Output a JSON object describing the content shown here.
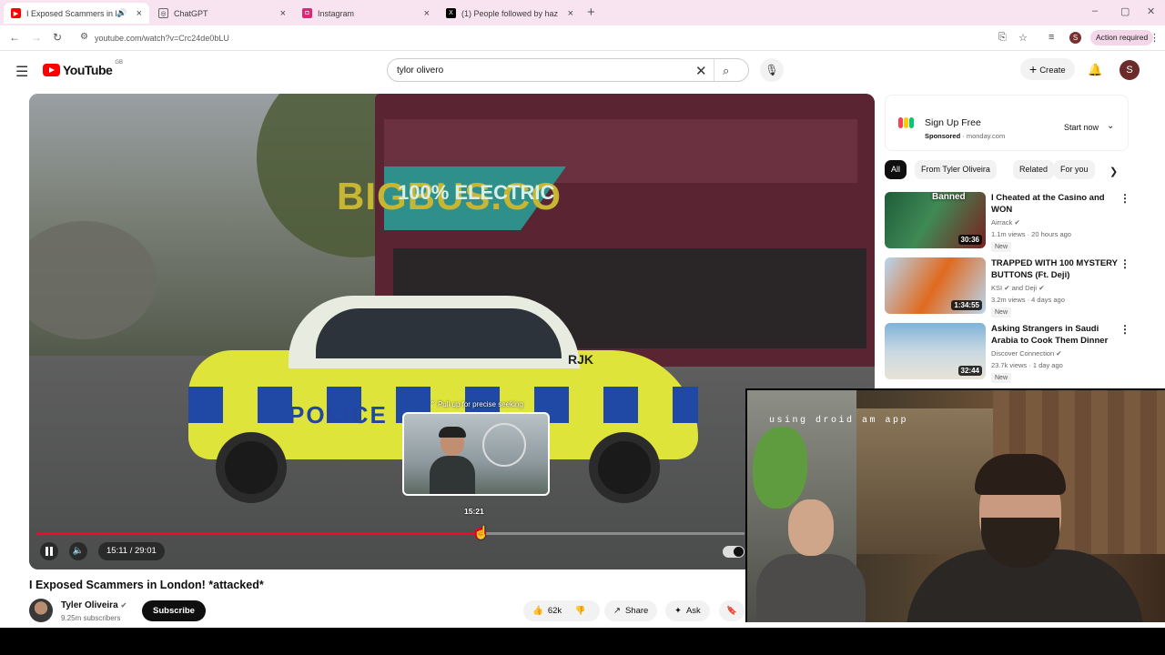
{
  "browser": {
    "tabs": [
      {
        "title": "I Exposed Scammers in Lon",
        "favicon_color": "#ff0000",
        "active": true,
        "audio": true
      },
      {
        "title": "ChatGPT",
        "favicon_color": "#ffffff",
        "active": false
      },
      {
        "title": "Instagram",
        "favicon_color": "#d62976",
        "active": false
      },
      {
        "title": "(1) People followed by haz",
        "favicon_color": "#000000",
        "active": false
      }
    ],
    "new_tab": "+",
    "url": "youtube.com/watch?v=Crc24de0bLU",
    "profile_initial": "S",
    "action_required": "Action required"
  },
  "youtube": {
    "logo_text": "YouTube",
    "country_code": "GB",
    "search_value": "tylor olivero",
    "create_label": "Create",
    "avatar_initial": "S"
  },
  "player": {
    "seek_hint": "Pull up for precise seeking",
    "preview_time": "15:21",
    "time_display": "15:11 / 29:01",
    "progress_fraction": 0.626,
    "scene_texts": {
      "bus": "BIGBUS.CO",
      "bus_electric": "100% ELECTRIC",
      "police": "POLICE",
      "plate": "RJK"
    }
  },
  "video": {
    "title": "I Exposed Scammers in London! *attacked*",
    "channel": "Tyler Oliveira",
    "subscribers": "9.25m subscribers",
    "subscribe_label": "Subscribe",
    "likes": "62k",
    "share_label": "Share",
    "ask_label": "Ask"
  },
  "ad": {
    "title": "Sign Up Free",
    "sponsored": "Sponsored",
    "domain": "monday.com",
    "cta": "Start now",
    "logo_colors": [
      "#ff3d57",
      "#ffcb00",
      "#00ca72"
    ]
  },
  "chips": [
    "All",
    "From Tyler Oliveira",
    "Related",
    "For you"
  ],
  "recommendations": [
    {
      "title": "I Cheated at the Casino and WON",
      "channel": "Airrack",
      "meta": "1.1m views · 20 hours ago",
      "badge": "New",
      "duration": "30:36",
      "overlay": "Banned",
      "colors": [
        "#1f5c3a",
        "#7a2020"
      ]
    },
    {
      "title": "TRAPPED WITH 100 MYSTERY BUTTONS (Ft. Deji)",
      "channel": "KSI",
      "channel_extra": "and Deji",
      "meta": "3.2m views · 4 days ago",
      "badge": "New",
      "duration": "1:34:55",
      "overlay": "",
      "colors": [
        "#e06a1f",
        "#b7d7f0"
      ]
    },
    {
      "title": "Asking Strangers in Saudi Arabia to Cook Them Dinner",
      "channel": "Discover Connection",
      "meta": "23.7k views · 1 day ago",
      "badge": "New",
      "duration": "32:44",
      "overlay": "",
      "colors": [
        "#7fb3d9",
        "#e8e2d7"
      ]
    }
  ],
  "webcam": {
    "caption": "using droid am app"
  }
}
